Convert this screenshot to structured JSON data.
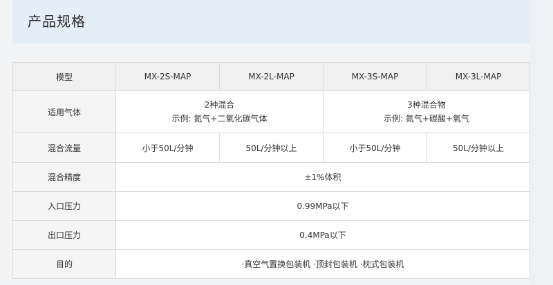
{
  "page": {
    "title": "产品规格"
  },
  "table": {
    "header": {
      "label": "模型",
      "models": [
        "MX-2S-MAP",
        "MX-2L-MAP",
        "MX-3S-MAP",
        "MX-3L-MAP"
      ]
    },
    "gas": {
      "label": "适用气体",
      "two": {
        "title": "2种混合",
        "example": "示例: 氮气+二氧化碳气体"
      },
      "three": {
        "title": "3种混合物",
        "example": "示例: 氮气+碳酸+氧气"
      }
    },
    "flow": {
      "label": "混合流量",
      "values": [
        "小于50L/分钟",
        "50L/分钟以上",
        "小于50L/分钟",
        "50L/分钟以上"
      ]
    },
    "accuracy": {
      "label": "混合精度",
      "value": "±1%体积"
    },
    "inlet": {
      "label": "入口压力",
      "value": "0.99MPa以下"
    },
    "outlet": {
      "label": "出口压力",
      "value": "0.4MPa以下"
    },
    "purpose": {
      "label": "目的",
      "value": "·真空气置换包装机 ·顶封包装机 ·枕式包装机"
    }
  }
}
